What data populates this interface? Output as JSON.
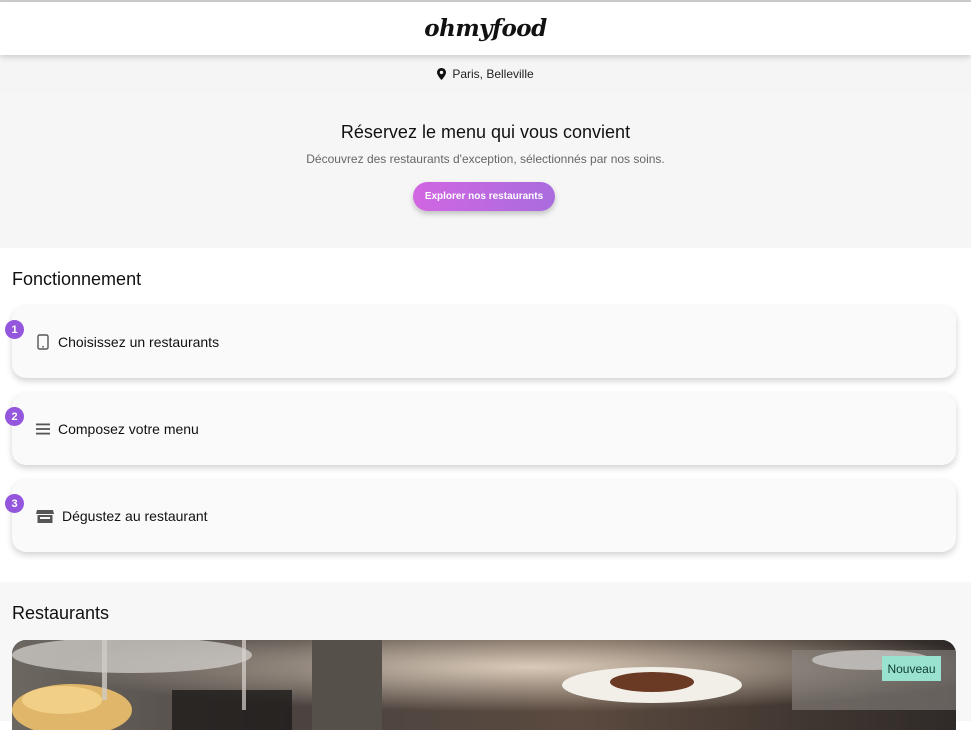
{
  "header": {
    "logo_text": "ohmyfood"
  },
  "location": {
    "icon": "map-pin-icon",
    "text": "Paris, Belleville"
  },
  "hero": {
    "title": "Réservez le menu qui vous convient",
    "subtitle": "Découvrez des restaurants d'exception, sélectionnés par nos soins.",
    "cta_label": "Explorer nos restaurants"
  },
  "how_it_works": {
    "title": "Fonctionnement",
    "steps": [
      {
        "number": "1",
        "icon": "mobile-phone-icon",
        "label": "Choisissez un restaurants"
      },
      {
        "number": "2",
        "icon": "list-icon",
        "label": "Composez votre menu"
      },
      {
        "number": "3",
        "icon": "store-icon",
        "label": "Dégustez au restaurant"
      }
    ]
  },
  "restaurants": {
    "title": "Restaurants",
    "cards": [
      {
        "badge": "Nouveau"
      }
    ]
  },
  "colors": {
    "accent_purple": "#9356dc",
    "button_gradient_start": "#d166e2",
    "button_gradient_end": "#a96cde",
    "new_badge": "#99e2d0"
  }
}
